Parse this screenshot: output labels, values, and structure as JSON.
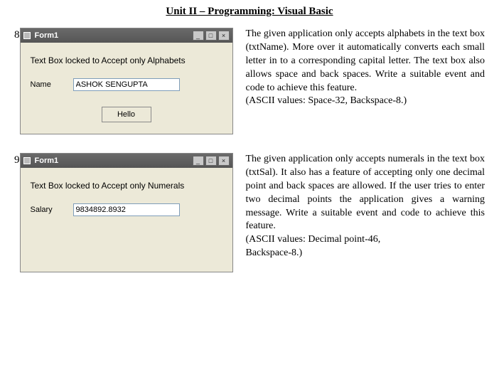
{
  "page": {
    "title": "Unit II – Programming: Visual Basic"
  },
  "q8": {
    "number": "8",
    "window_title": "Form1",
    "heading": "Text Box locked to Accept only Alphabets",
    "field_label": "Name",
    "field_value": "ASHOK SENGUPTA",
    "button_label": "Hello",
    "desc": "The given application only accepts alphabets in the text box (txtName). More over it automatically converts each small letter in to a corresponding capital letter.  The text box also allows space and back spaces. Write a suitable event and code to achieve this feature.",
    "ascii": "(ASCII values: Space-32, Backspace-8.)"
  },
  "q9": {
    "number": "9",
    "window_title": "Form1",
    "heading": "Text Box locked to Accept only Numerals",
    "field_label": "Salary",
    "field_value": "9834892.8932",
    "desc": "The given application only accepts numerals in the text box (txtSal). It also has a feature of accepting only one decimal point and back spaces are allowed. If the user tries to enter two decimal points the application gives a warning message. Write a suitable event and code to achieve this feature.",
    "ascii1": "(ASCII values: Decimal point-46,",
    "ascii2": "Backspace-8.)"
  },
  "win_buttons": {
    "min": "_",
    "max": "□",
    "close": "×"
  }
}
